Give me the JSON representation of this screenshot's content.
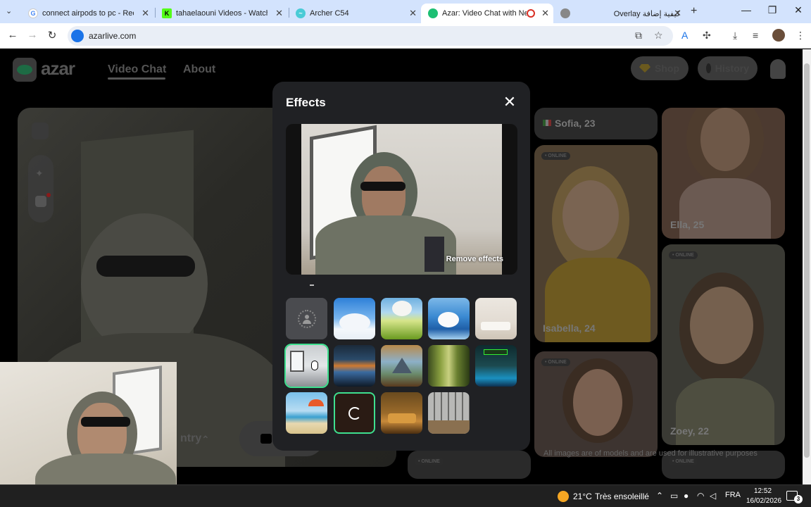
{
  "browser": {
    "tabs": [
      {
        "title": "connect airpods to pc - Recher",
        "favicon": "google-icon"
      },
      {
        "title": "tahaelaouni Videos - Watch On",
        "favicon": "kick-icon"
      },
      {
        "title": "Archer C54",
        "favicon": "tplink-icon"
      },
      {
        "title": "Azar: Video Chat with New",
        "favicon": "azar-icon"
      },
      {
        "title": "Overlay كيفية إضافة",
        "favicon": "globe-icon"
      }
    ],
    "url": "azarlive.com"
  },
  "site": {
    "logo_text": "azar",
    "nav": {
      "video_chat": "Video Chat",
      "about": "About"
    },
    "shop_label": "Shop",
    "history_label": "History",
    "country_label": "ntry",
    "disclaimer": "All images are of models and are used for illustrative purposes"
  },
  "gallery": {
    "online_label": "• ONLINE",
    "cards": [
      {
        "name": "Sofia, 23"
      },
      {
        "name": "Ella, 25"
      },
      {
        "name": "Isabella, 24"
      },
      {
        "name": "Zoey, 22"
      }
    ]
  },
  "modal": {
    "title": "Effects",
    "remove_label": "Remove effects",
    "effects": [
      {
        "id": "blur",
        "icon": "person-blur-icon"
      },
      {
        "id": "sky-clouds"
      },
      {
        "id": "cat-meadow"
      },
      {
        "id": "dog-ocean"
      },
      {
        "id": "white-living-room"
      },
      {
        "id": "modern-office",
        "selected": true
      },
      {
        "id": "space-station"
      },
      {
        "id": "mountain-tent"
      },
      {
        "id": "forest"
      },
      {
        "id": "neon-arcade"
      },
      {
        "id": "beach"
      },
      {
        "id": "loading",
        "loading": true
      },
      {
        "id": "golden-lounge"
      },
      {
        "id": "library-shelf"
      }
    ]
  },
  "taskbar": {
    "temperature": "21°C",
    "weather": "Très ensoleillé",
    "language": "FRA",
    "time": "12:52",
    "date": "16/02/2026",
    "notifications": "3"
  },
  "colors": {
    "accent": "#3ee08f",
    "modal_bg": "#202124",
    "tab_bar": "#d3e3fd"
  }
}
